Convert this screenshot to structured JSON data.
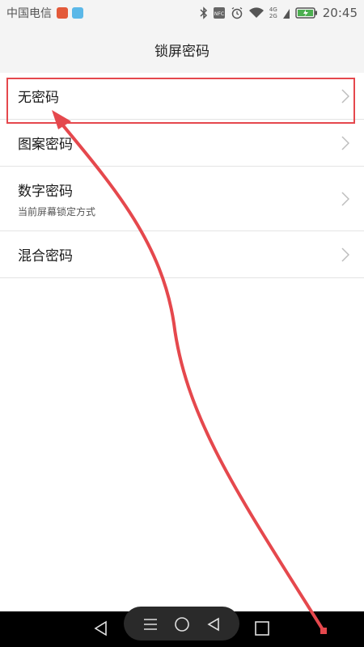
{
  "status_bar": {
    "carrier": "中国电信",
    "network_badge_top": "4G",
    "network_badge_bottom": "2G",
    "time": "20:45",
    "icons": [
      "app-notification-icon",
      "gallery-notification-icon",
      "bluetooth-icon",
      "nfc-icon",
      "alarm-icon",
      "wifi-icon",
      "signal-icon",
      "battery-charging-icon"
    ],
    "nfc_label": "NFC"
  },
  "header": {
    "title": "锁屏密码"
  },
  "options": [
    {
      "label": "无密码",
      "subtitle": ""
    },
    {
      "label": "图案密码",
      "subtitle": ""
    },
    {
      "label": "数字密码",
      "subtitle": "当前屏幕锁定方式"
    },
    {
      "label": "混合密码",
      "subtitle": ""
    }
  ],
  "annotation": {
    "highlight_color": "#e5484d",
    "arrow_color": "#e5484d"
  },
  "navigation_bar": {
    "buttons": [
      "back-icon",
      "menu-icon",
      "home-icon",
      "back-small-icon",
      "recent-apps-icon"
    ]
  },
  "colors": {
    "background": "#ffffff",
    "header_bg": "#f4f4f4",
    "divider": "#e4e4e4",
    "navbar_bg": "#000000"
  }
}
